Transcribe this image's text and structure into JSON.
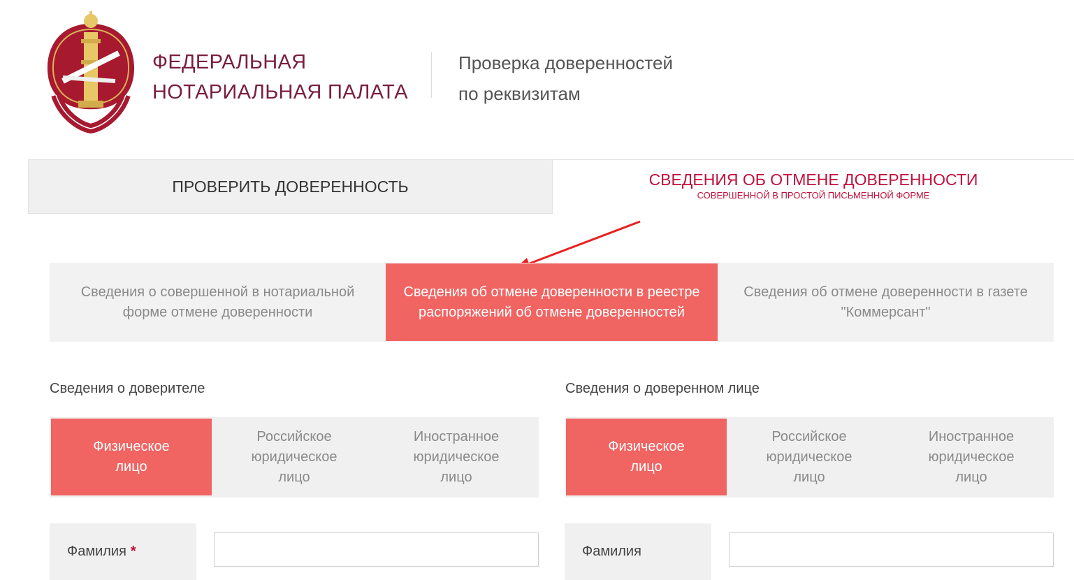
{
  "header": {
    "org_name_line1": "ФЕДЕРАЛЬНАЯ",
    "org_name_line2": "НОТАРИАЛЬНАЯ ПАЛАТА",
    "subtitle_line1": "Проверка доверенностей",
    "subtitle_line2": "по реквизитам",
    "logo_icon": "notary-emblem-icon"
  },
  "main_tabs": [
    {
      "label": "ПРОВЕРИТЬ ДОВЕРЕННОСТЬ"
    },
    {
      "label": "СВЕДЕНИЯ ОБ ОТМЕНЕ ДОВЕРЕННОСТИ",
      "sublabel": "СОВЕРШЕННОЙ В ПРОСТОЙ ПИСЬМЕННОЙ ФОРМЕ"
    }
  ],
  "sub_tabs": [
    {
      "label": "Сведения о совершенной в нотариальной форме отмене доверенности"
    },
    {
      "label": "Сведения об отмене доверенности в реестре распоряжений об отмене доверенностей"
    },
    {
      "label": "Сведения об отмене доверенности в газете \"Коммерсант\""
    }
  ],
  "principal": {
    "title": "Сведения о доверителе",
    "options": [
      "Физическое лицо",
      "Российское юридическое лицо",
      "Иностранное юридическое лицо"
    ],
    "field_label": "Фамилия",
    "required_mark": "*",
    "field_value": ""
  },
  "attorney": {
    "title": "Сведения о доверенном лице",
    "options": [
      "Физическое лицо",
      "Российское юридическое лицо",
      "Иностранное юридическое лицо"
    ],
    "field_label": "Фамилия",
    "field_value": ""
  },
  "colors": {
    "brand": "#7a1e3c",
    "accent": "#c0103c",
    "active_tab": "#f06462",
    "arrow": "#e8201f"
  }
}
